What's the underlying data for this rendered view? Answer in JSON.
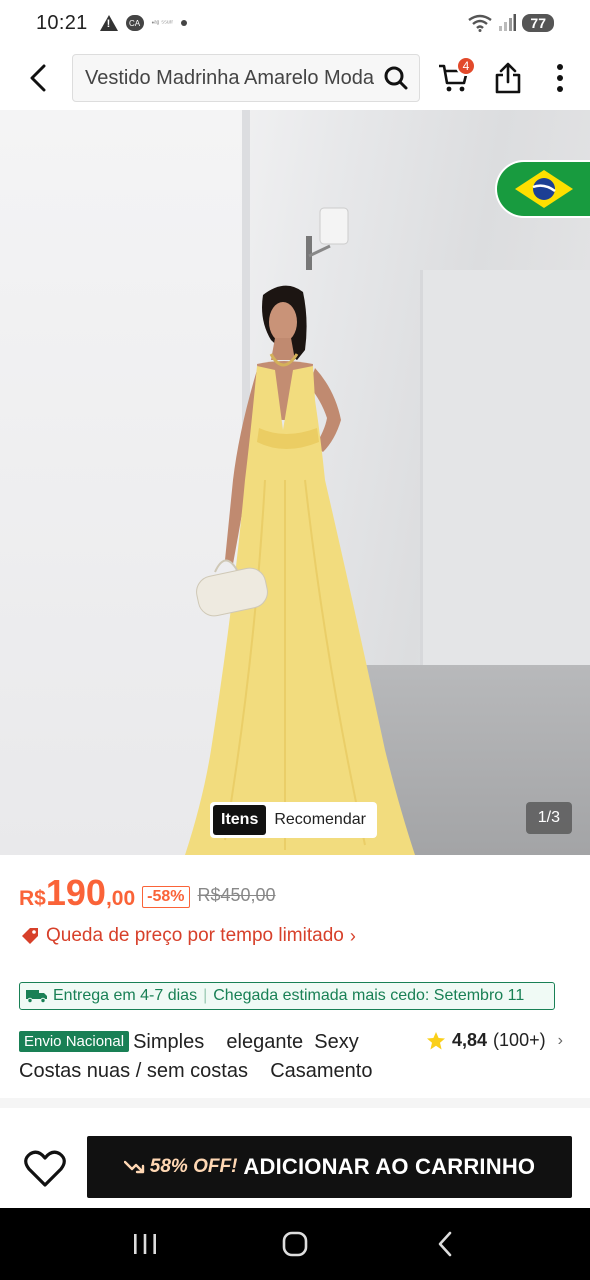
{
  "status_bar": {
    "time": "10:21",
    "ca_badge": "CA",
    "tiny_text": "•ᵃᵍ ⁵⁵ᵘʳʳ",
    "battery": "77"
  },
  "header": {
    "search_value": "Vestido Madrinha Amarelo Moda",
    "cart_count": "4",
    "icons": [
      "back-arrow-icon",
      "search-icon",
      "cart-icon",
      "share-icon",
      "more-vertical-icon"
    ]
  },
  "gallery": {
    "tabs": [
      {
        "label": "Itens",
        "active": true
      },
      {
        "label": "Recomendar",
        "active": false
      }
    ],
    "counter": "1/3",
    "flag": "brazil-flag-icon"
  },
  "price": {
    "currency": "R$",
    "integer": "190",
    "decimal": ",00",
    "discount": "-58%",
    "original": "R$450,00"
  },
  "price_drop": {
    "label": "Queda de preço por tempo limitado",
    "chevron": "›"
  },
  "delivery": {
    "left": "Entrega em 4-7 dias",
    "separator": "|",
    "right": "Chegada estimada mais cedo: Setembro 11"
  },
  "product": {
    "badge": "Envio Nacional",
    "title": "Simples    elegante  Sexy Costas nuas / sem costas    Casamento"
  },
  "rating": {
    "score": "4,84",
    "count": "(100+)",
    "chevron": "›"
  },
  "action_bar": {
    "promo": "58% OFF!",
    "add_to_cart": "ADICIONAR AO CARRINHO"
  },
  "colors": {
    "price_accent": "#fa6338",
    "drop_red": "#d7402a",
    "green": "#198055",
    "brand_black": "#111111"
  }
}
